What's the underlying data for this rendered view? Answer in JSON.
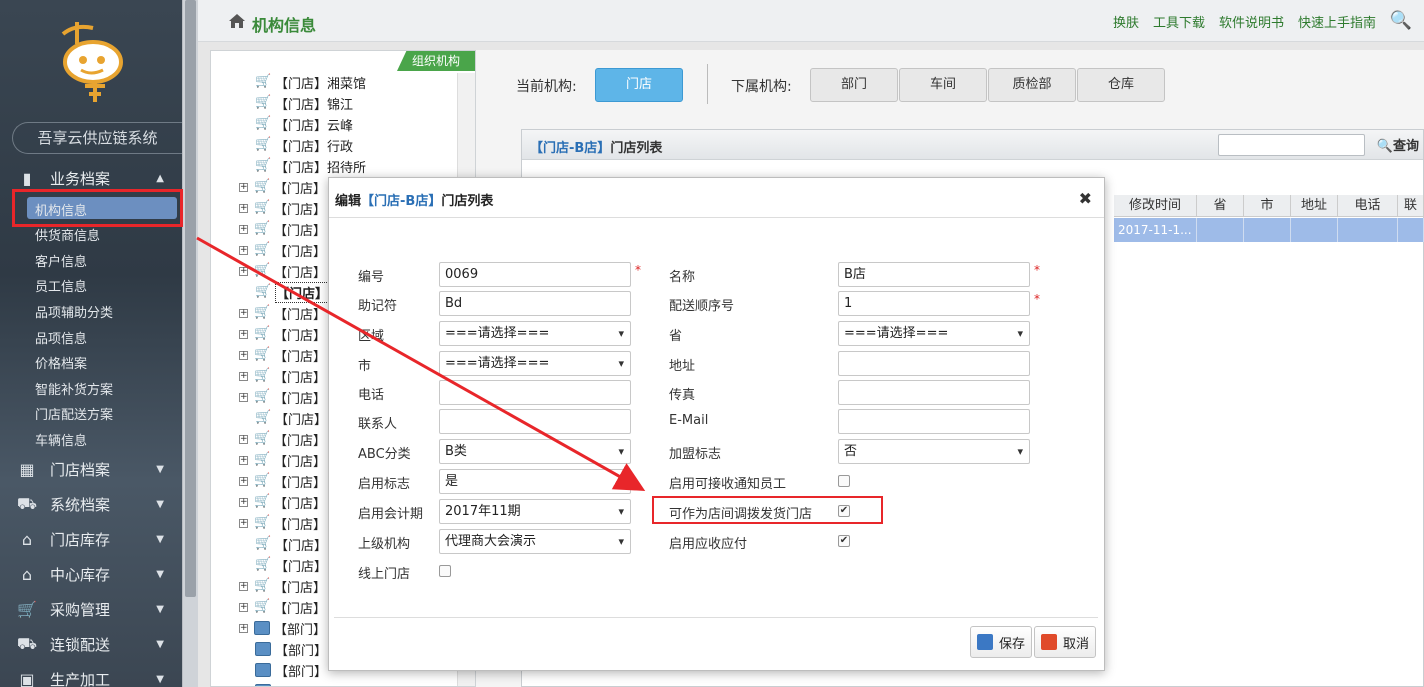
{
  "sidebar": {
    "system_title": "吾享云供应链系统",
    "menu": [
      {
        "label": "业务档案",
        "icon": "folder-icon"
      },
      {
        "label": "门店档案",
        "icon": "store-icon"
      },
      {
        "label": "系统档案",
        "icon": "truck-icon"
      },
      {
        "label": "门店库存",
        "icon": "warehouse-icon"
      },
      {
        "label": "中心库存",
        "icon": "warehouse-icon"
      },
      {
        "label": "采购管理",
        "icon": "cart-icon"
      },
      {
        "label": "连锁配送",
        "icon": "delivery-icon"
      },
      {
        "label": "生产加工",
        "icon": "factory-icon"
      }
    ],
    "submenu": [
      "机构信息",
      "供货商信息",
      "客户信息",
      "员工信息",
      "品项辅助分类",
      "品项信息",
      "价格档案",
      "智能补货方案",
      "门店配送方案",
      "车辆信息"
    ]
  },
  "header": {
    "title": "机构信息",
    "links": [
      "换肤",
      "工具下载",
      "软件说明书",
      "快速上手指南"
    ]
  },
  "tree": {
    "tag": "组织机构",
    "nodes": [
      "【门店】湘菜馆",
      "【门店】锦江",
      "【门店】云峰",
      "【门店】行政",
      "【门店】招待所",
      "【门店】",
      "【门店】",
      "【门店】",
      "【门店】",
      "【门店】",
      "【门店】",
      "【门店】",
      "【门店】",
      "【门店】",
      "【门店】",
      "【门店】",
      "【门店】",
      "【门店】",
      "【门店】",
      "【门店】",
      "【门店】",
      "【门店】",
      "【门店】",
      "【门店】",
      "【门店】",
      "【门店】",
      "【部门】",
      "【部门】",
      "【部门】",
      "【部门】"
    ]
  },
  "org": {
    "current_label": "当前机构:",
    "current_btn": "门店",
    "sub_label": "下属机构:",
    "sub_btns": [
      "部门",
      "车间",
      "质检部",
      "仓库"
    ]
  },
  "list": {
    "title_hl": "【门店-B店】",
    "title_rest": "门店列表",
    "search_label": "查询",
    "columns": [
      "修改时间",
      "省",
      "市",
      "地址",
      "电话",
      "联系"
    ],
    "row": [
      "2017-11-1...",
      "",
      "",
      "",
      "",
      ""
    ]
  },
  "modal": {
    "title_prefix": "编辑",
    "title_hl": "【门店-B店】",
    "title_rest": "门店列表",
    "close": "✖",
    "fields_left": [
      {
        "label": "编号",
        "value": "0069",
        "type": "input",
        "required": true
      },
      {
        "label": "助记符",
        "value": "Bd",
        "type": "input"
      },
      {
        "label": "区域",
        "value": "===请选择===",
        "type": "select"
      },
      {
        "label": "市",
        "value": "===请选择===",
        "type": "select"
      },
      {
        "label": "电话",
        "value": "",
        "type": "input"
      },
      {
        "label": "联系人",
        "value": "",
        "type": "input"
      },
      {
        "label": "ABC分类",
        "value": "B类",
        "type": "select"
      },
      {
        "label": "启用标志",
        "value": "是",
        "type": "input"
      },
      {
        "label": "启用会计期",
        "value": "2017年11期",
        "type": "select"
      },
      {
        "label": "上级机构",
        "value": "代理商大会演示",
        "type": "select"
      },
      {
        "label": "线上门店",
        "value": "",
        "type": "checkbox",
        "checked": false
      }
    ],
    "fields_right": [
      {
        "label": "名称",
        "value": "B店",
        "type": "input",
        "required": true
      },
      {
        "label": "配送顺序号",
        "value": "1",
        "type": "input",
        "required": true
      },
      {
        "label": "省",
        "value": "===请选择===",
        "type": "select"
      },
      {
        "label": "地址",
        "value": "",
        "type": "input"
      },
      {
        "label": "传真",
        "value": "",
        "type": "input"
      },
      {
        "label": "E-Mail",
        "value": "",
        "type": "input"
      },
      {
        "label": "加盟标志",
        "value": "否",
        "type": "select"
      },
      {
        "label": "启用可接收通知员工",
        "value": "",
        "type": "checkbox",
        "checked": false
      },
      {
        "label": "可作为店间调拨发货门店",
        "value": "",
        "type": "checkbox",
        "checked": true
      },
      {
        "label": "启用应收应付",
        "value": "",
        "type": "checkbox",
        "checked": true
      }
    ],
    "save_label": "保存",
    "cancel_label": "取消"
  },
  "colors": {
    "accent": "#5eb5e8",
    "highlight_red": "#e8262a",
    "title_green": "#3a8a3a"
  }
}
